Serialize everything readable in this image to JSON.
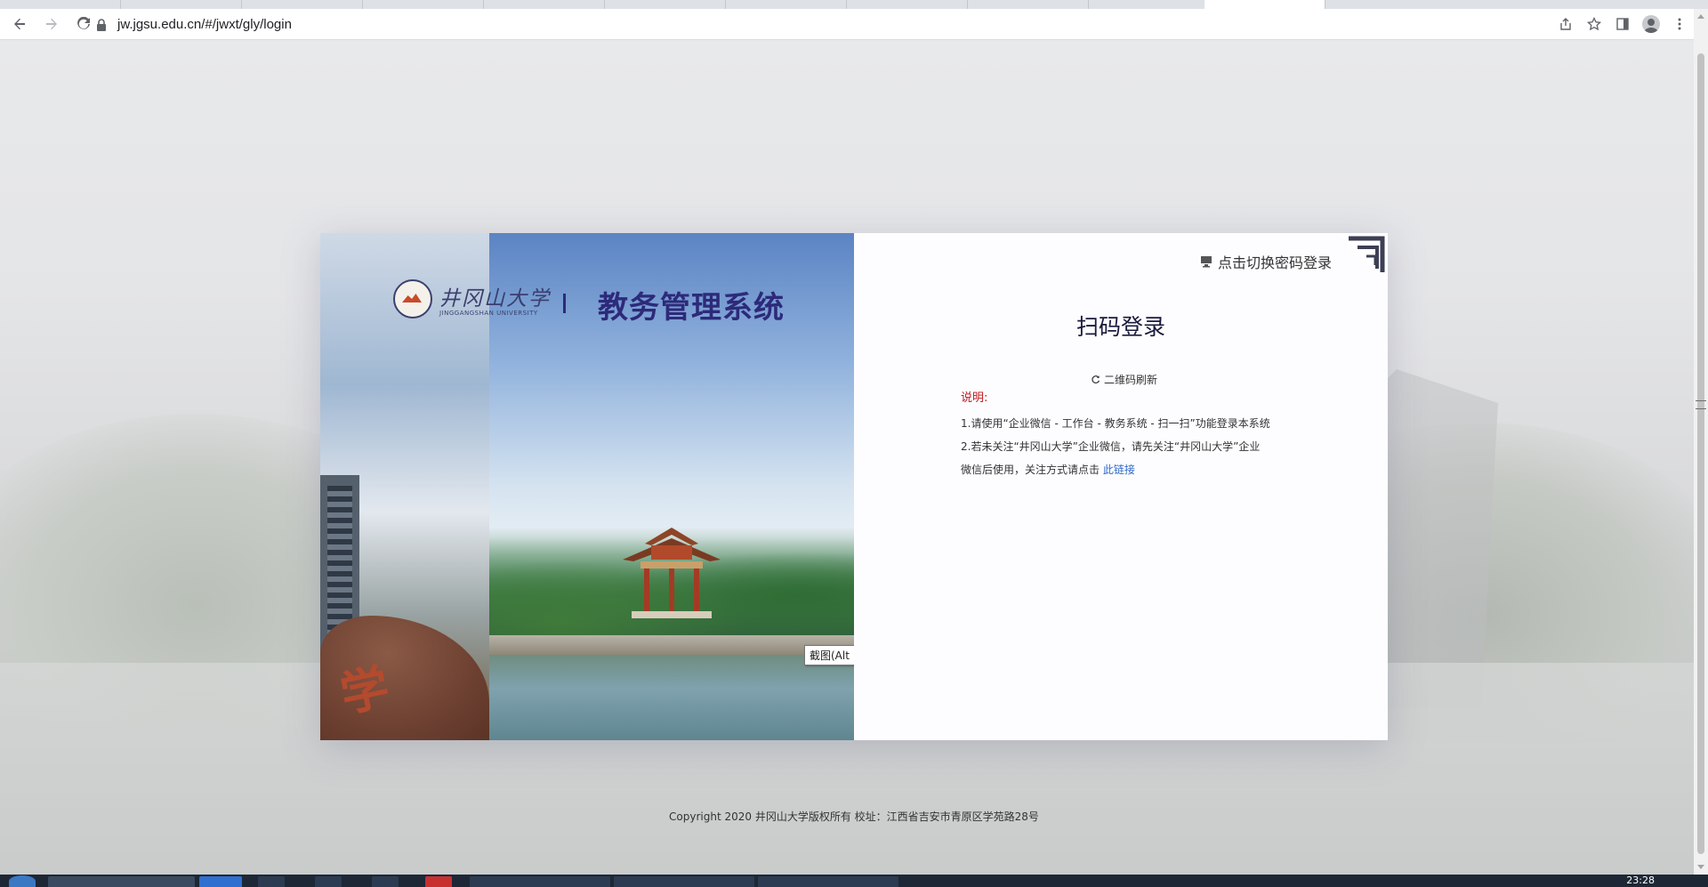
{
  "browser": {
    "url": "jw.jgsu.edu.cn/#/jwxt/gly/login",
    "icons": {
      "back": "back-arrow-icon",
      "forward": "forward-arrow-icon",
      "reload": "reload-icon",
      "lock": "lock-icon",
      "share": "share-icon",
      "bookmark": "star-icon",
      "sidepanel": "side-panel-icon",
      "profile": "profile-icon",
      "menu": "kebab-menu-icon"
    }
  },
  "header": {
    "school_name_cn": "井冈山大学",
    "school_name_en": "JINGGANGSHAN UNIVERSITY",
    "system_title": "教务管理系统"
  },
  "banner": {
    "rock_char": "学"
  },
  "screenshot_tooltip": "截图(Alt + A)",
  "login": {
    "switch_label": "点击切换密码登录",
    "title": "扫码登录",
    "refresh_label": "二维码刷新",
    "desc_title": "说明:",
    "desc_line1": "1.请使用“企业微信 - 工作台 - 教务系统 - 扫一扫”功能登录本系统",
    "desc_line2": "2.若未关注“井冈山大学”企业微信，请先关注“井冈山大学”企业",
    "desc_line3": "微信后使用，关注方式请点击",
    "desc_link": "此链接"
  },
  "footer": {
    "copyright": "Copyright 2020 井冈山大学版权所有 校址：江西省吉安市青原区学苑路28号"
  },
  "taskbar": {
    "clock": "23:28"
  },
  "colors": {
    "title_color": "#2d2a7a",
    "link_color": "#2c68c8",
    "notice_red": "#c0181b"
  }
}
